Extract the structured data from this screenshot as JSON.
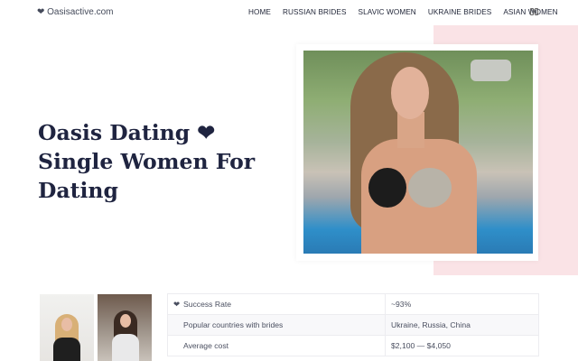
{
  "header": {
    "logo": "❤ Oasisactive.com",
    "nav": [
      "HOME",
      "RUSSIAN BRIDES",
      "SLAVIC WOMEN",
      "UKRAINE BRIDES",
      "ASIAN WOMEN"
    ],
    "lang_icon": "language-switch-icon"
  },
  "hero": {
    "title": "Oasis Dating ❤ Single Women For Dating",
    "accent_color": "#fae3e6",
    "photo_icon": "woman-photo"
  },
  "stats": [
    {
      "icon": "❤",
      "label": "Success Rate",
      "value": "~93%"
    },
    {
      "icon": "",
      "label": "Popular countries with brides",
      "value": "Ukraine, Russia, China"
    },
    {
      "icon": "",
      "label": "Average cost",
      "value": "$2,100 — $4,050"
    }
  ]
}
